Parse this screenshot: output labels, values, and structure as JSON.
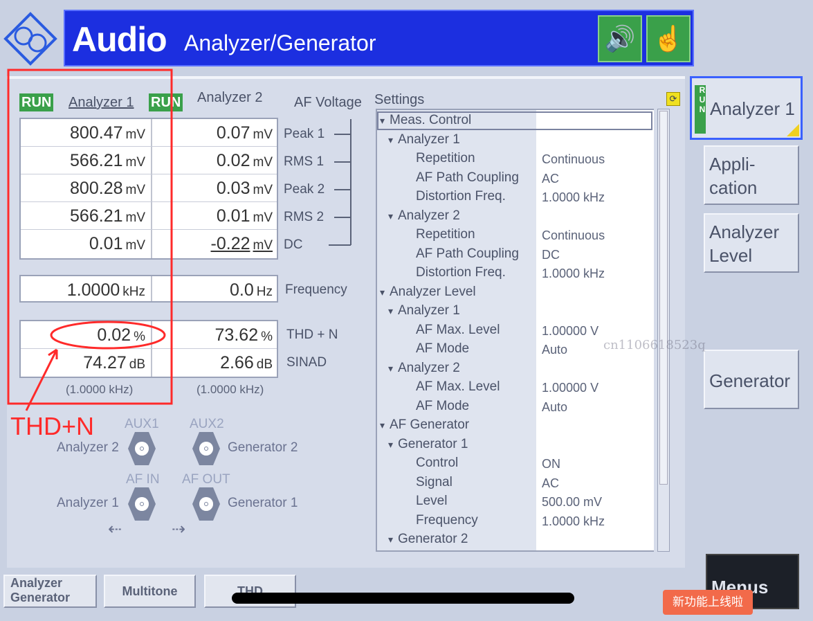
{
  "header": {
    "title_main": "Audio",
    "title_sub": "Analyzer/Generator",
    "logo": "R&S",
    "icons": [
      "speaker-icon",
      "touch-hand-icon"
    ]
  },
  "analyzers": {
    "run_label": "RUN",
    "analyzer1": "Analyzer 1",
    "analyzer2": "Analyzer 2",
    "group_label": "AF Voltage"
  },
  "measurements": [
    {
      "a1": "800.47",
      "u1": "mV",
      "a2": "0.07",
      "u2": "mV",
      "label": "Peak 1"
    },
    {
      "a1": "566.21",
      "u1": "mV",
      "a2": "0.02",
      "u2": "mV",
      "label": "RMS 1"
    },
    {
      "a1": "800.28",
      "u1": "mV",
      "a2": "0.03",
      "u2": "mV",
      "label": "Peak 2"
    },
    {
      "a1": "566.21",
      "u1": "mV",
      "a2": "0.01",
      "u2": "mV",
      "label": "RMS 2"
    },
    {
      "a1": "0.01",
      "u1": "mV",
      "a2": "-0.22",
      "u2": "mV",
      "label": "DC"
    }
  ],
  "frequency": {
    "a1": "1.0000",
    "u1": "kHz",
    "a2": "0.0",
    "u2": "Hz",
    "label": "Frequency"
  },
  "distortion": [
    {
      "a1": "0.02",
      "u1": "%",
      "a2": "73.62",
      "u2": "%",
      "label": "THD + N"
    },
    {
      "a1": "74.27",
      "u1": "dB",
      "a2": "2.66",
      "u2": "dB",
      "label": "SINAD"
    }
  ],
  "distortion_freq": {
    "a1": "(1.0000 kHz)",
    "a2": "(1.0000 kHz)"
  },
  "annotation": {
    "text": "THD+N",
    "color": "#ff2a2a"
  },
  "connectors": {
    "aux1": "AUX1",
    "aux2": "AUX2",
    "afin": "AF IN",
    "afout": "AF OUT",
    "an2": "Analyzer 2",
    "gen2": "Generator 2",
    "an1": "Analyzer 1",
    "gen1": "Generator 1"
  },
  "settings": {
    "title": "Settings",
    "rows": [
      {
        "label": "Meas. Control",
        "level": 0,
        "expand": true,
        "value": ""
      },
      {
        "label": "Analyzer 1",
        "level": 1,
        "expand": true,
        "value": ""
      },
      {
        "label": "Repetition",
        "level": 2,
        "value": "Continuous"
      },
      {
        "label": "AF Path Coupling",
        "level": 2,
        "value": "AC"
      },
      {
        "label": "Distortion Freq.",
        "level": 2,
        "value": "1.0000  kHz"
      },
      {
        "label": "Analyzer 2",
        "level": 1,
        "expand": true,
        "value": ""
      },
      {
        "label": "Repetition",
        "level": 2,
        "value": "Continuous"
      },
      {
        "label": "AF Path Coupling",
        "level": 2,
        "value": "DC"
      },
      {
        "label": "Distortion Freq.",
        "level": 2,
        "value": "1.0000  kHz"
      },
      {
        "label": "Analyzer Level",
        "level": 0,
        "expand": true,
        "value": ""
      },
      {
        "label": "Analyzer 1",
        "level": 1,
        "expand": true,
        "value": ""
      },
      {
        "label": "AF Max. Level",
        "level": 2,
        "value": "1.00000  V"
      },
      {
        "label": "AF Mode",
        "level": 2,
        "value": "Auto"
      },
      {
        "label": "Analyzer 2",
        "level": 1,
        "expand": true,
        "value": ""
      },
      {
        "label": "AF Max. Level",
        "level": 2,
        "value": "1.00000  V"
      },
      {
        "label": "AF Mode",
        "level": 2,
        "value": "Auto"
      },
      {
        "label": "AF Generator",
        "level": 0,
        "expand": true,
        "value": ""
      },
      {
        "label": "Generator 1",
        "level": 1,
        "expand": true,
        "value": ""
      },
      {
        "label": "Control",
        "level": 2,
        "value": "ON"
      },
      {
        "label": "Signal",
        "level": 2,
        "value": "AC"
      },
      {
        "label": "Level",
        "level": 2,
        "value": "500.00  mV"
      },
      {
        "label": "Frequency",
        "level": 2,
        "value": "1.0000  kHz"
      },
      {
        "label": "Generator 2",
        "level": 1,
        "expand": true,
        "value": ""
      }
    ]
  },
  "right_menu": {
    "run": "RUN",
    "analyzer1": "Analyzer 1",
    "application": "Appli-\ncation",
    "analyzer_level": "Analyzer\nLevel",
    "generator": "Generator",
    "menus": "Menus"
  },
  "bottom_tabs": [
    "Analyzer\nGenerator",
    "Multitone",
    "THD"
  ],
  "watermark": "cn1106618523q",
  "toast": "新功能上线啦"
}
